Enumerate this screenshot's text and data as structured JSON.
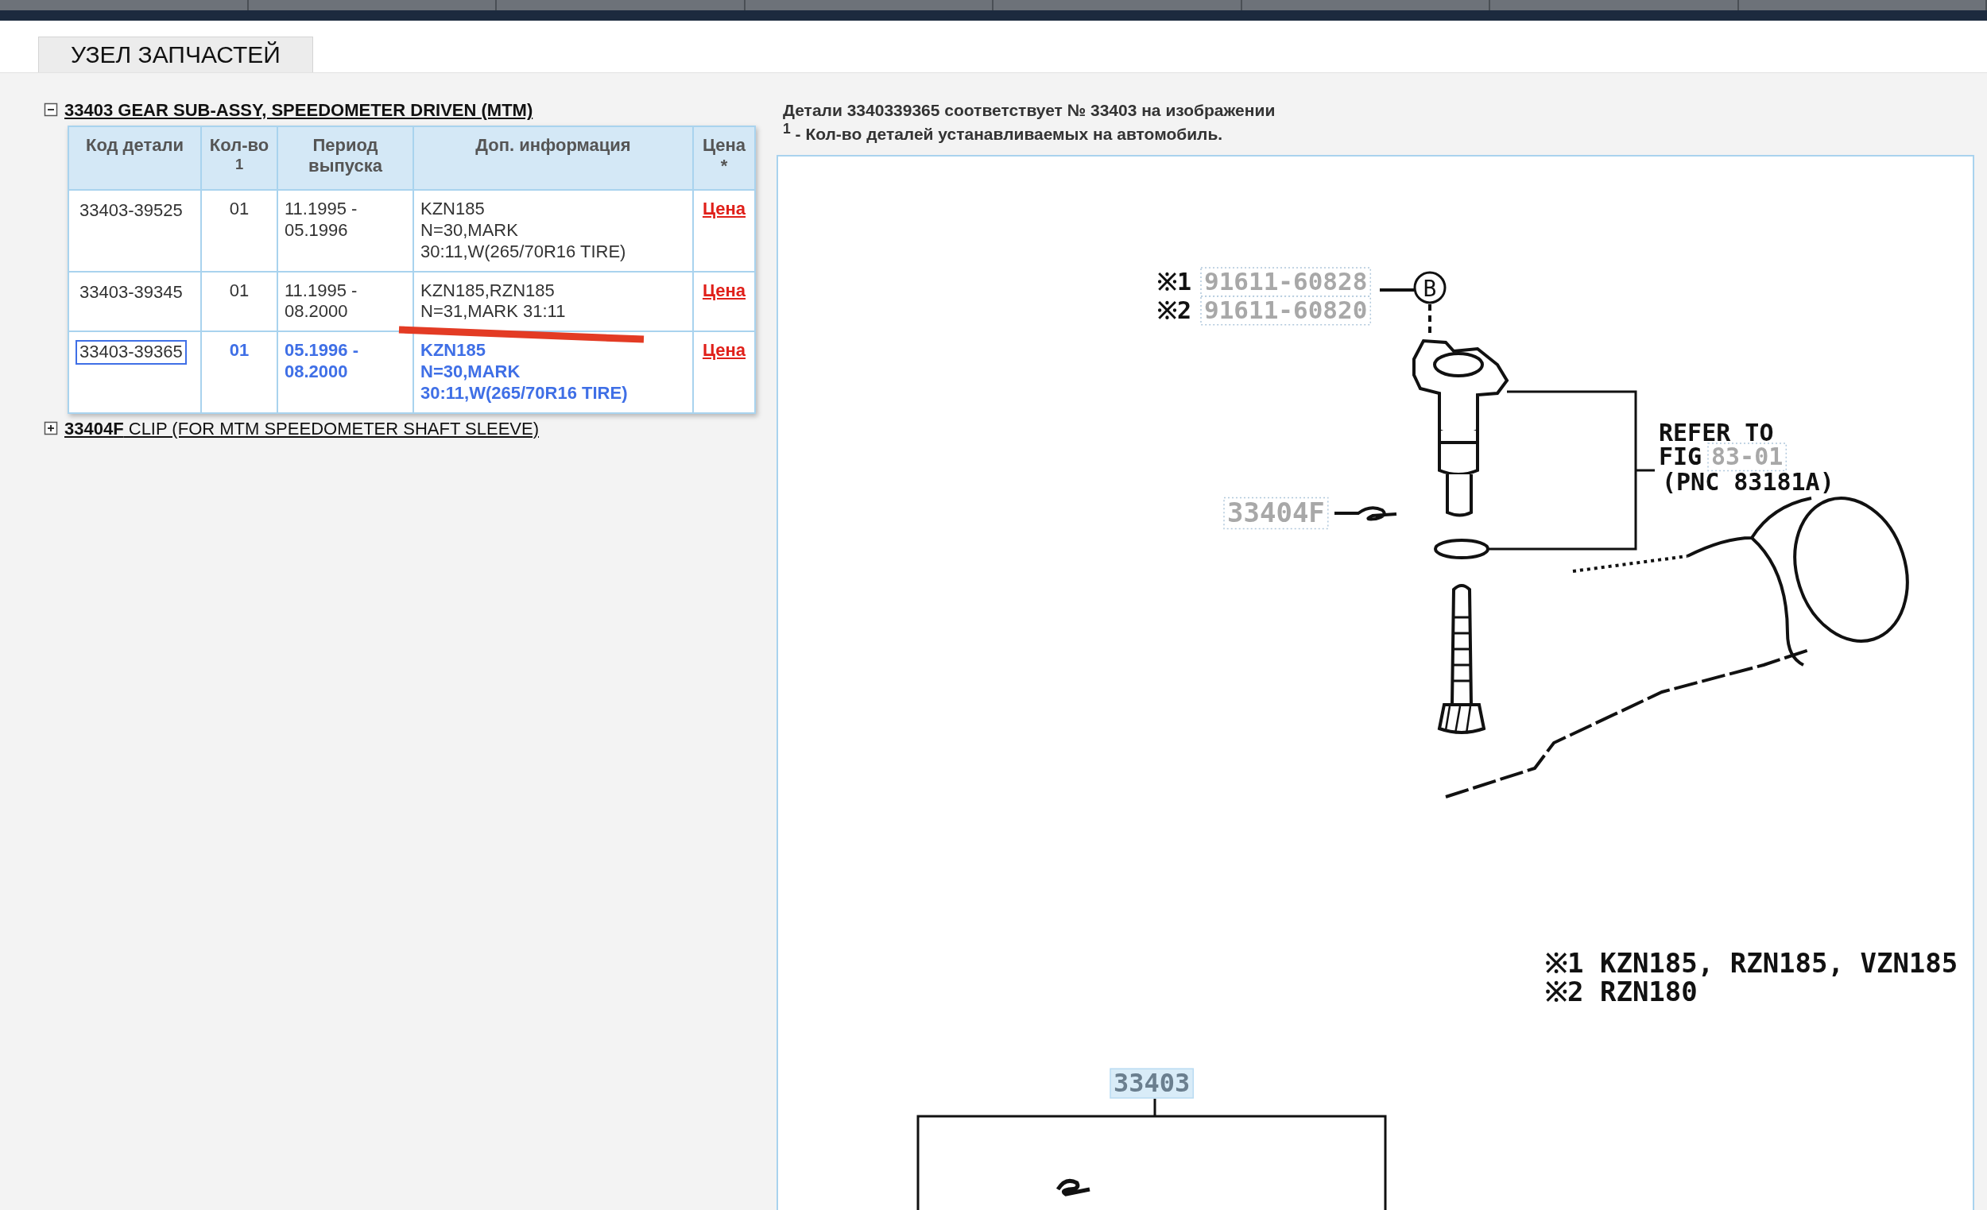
{
  "tab": {
    "label": "УЗЕЛ ЗАПЧАСТЕЙ",
    "selected": true
  },
  "groups": [
    {
      "title": "33403 GEAR SUB-ASSY, SPEEDOMETER DRIVEN (MTM)",
      "expanded": true,
      "selected": true,
      "table": {
        "columns": [
          "Код детали",
          "Кол-во $^{1}$",
          "Период выпуска",
          "Доп. информация",
          "Цена *"
        ],
        "rows": [
          {
            "code": "33403-39525",
            "qty": "01",
            "period": "11.1995 -\n05.1996",
            "info": "KZN185\nN=30,MARK\n30:11,W(265/70R16 TIRE)",
            "price": "Цена",
            "selected": false
          },
          {
            "code": "33403-39345",
            "qty": "01",
            "period": "11.1995 -\n08.2000",
            "info": "KZN185,RZN185\nN=31,MARK 31:11",
            "price": "Цена",
            "selected": false
          },
          {
            "code": "33403-39365",
            "qty": "01",
            "period": "05.1996 -\n08.2000",
            "info": "KZN185\nN=30,MARK\n30:11,W(265/70R16 TIRE)",
            "price": "Цена",
            "selected": true
          }
        ]
      }
    },
    {
      "title": "**33404F** CLIP (FOR MTM SPEEDOMETER SHAFT SLEEVE)",
      "expanded": false,
      "selected": false
    }
  ],
  "note": {
    "text": "Детали 3340339365 соответствует № 33403 на изображении",
    "footnote": "$^{1}$ - Кол-во деталей устанавливаемых на автомобиль."
  },
  "diagram": {
    "bolt_notes": [
      {
        "mark": "※1",
        "part": "91611-60828"
      },
      {
        "mark": "※2",
        "part": "91611-60820"
      }
    ],
    "bolt_ref": "B",
    "refer": {
      "line1": "REFER TO",
      "line2": "FIG",
      "fig": "83-01",
      "line3": "(PNC 83181A)"
    },
    "clip_part": {
      "label": "33404F",
      "selected": false
    },
    "legend": [
      "※1 KZN185, RZN185, VZN185",
      "※2 RZN180"
    ],
    "assembly_part": {
      "label": "33403",
      "selected": true
    }
  }
}
